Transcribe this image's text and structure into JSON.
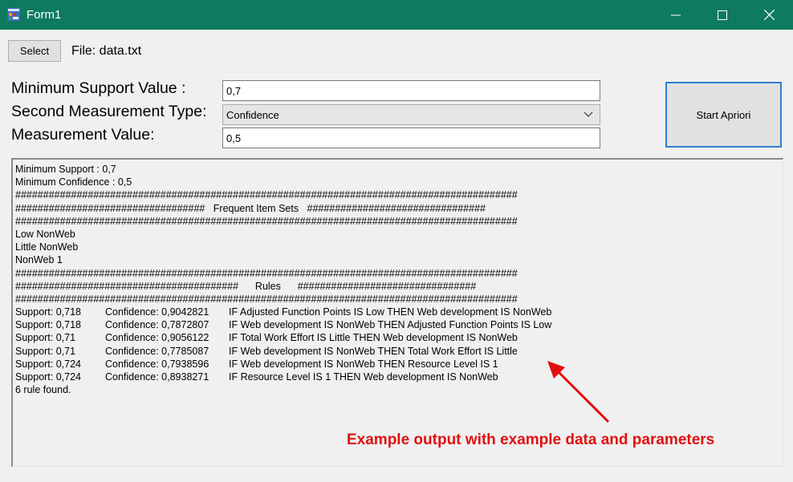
{
  "window": {
    "title": "Form1",
    "minimize_icon": "minimize-icon",
    "maximize_icon": "maximize-icon",
    "close_icon": "close-icon"
  },
  "file_bar": {
    "select_label": "Select",
    "file_label": "File: data.txt"
  },
  "form": {
    "min_support_label": "Minimum Support Value :",
    "min_support_value": "0,7",
    "measurement_type_label": "Second Measurement Type:",
    "measurement_type_selected": "Confidence",
    "measurement_value_label": "Measurement Value:",
    "measurement_value": "0,5",
    "start_label": "Start Apriori"
  },
  "output": {
    "header_lines": [
      "Minimum Support : 0,7",
      "Minimum Confidence : 0,5",
      "##########################################################################################",
      "##################################   Frequent Item Sets   ################################",
      "##########################################################################################",
      "Low NonWeb",
      "Little NonWeb",
      "NonWeb 1",
      "##########################################################################################",
      "########################################      Rules      ################################",
      "##########################################################################################"
    ],
    "rules": [
      {
        "support": "Support: 0,718",
        "confidence": "Confidence: 0,9042821",
        "rule": "IF Adjusted Function Points IS Low THEN Web development IS NonWeb"
      },
      {
        "support": "Support: 0,718",
        "confidence": "Confidence: 0,7872807",
        "rule": "IF Web development IS NonWeb THEN Adjusted Function Points IS Low"
      },
      {
        "support": "Support: 0,71",
        "confidence": "Confidence: 0,9056122",
        "rule": "IF Total Work Effort IS Little THEN Web development IS NonWeb"
      },
      {
        "support": "Support: 0,71",
        "confidence": "Confidence: 0,7785087",
        "rule": "IF Web development IS NonWeb THEN Total Work Effort IS Little"
      },
      {
        "support": "Support: 0,724",
        "confidence": "Confidence: 0,7938596",
        "rule": "IF Web development IS NonWeb THEN Resource Level IS 1"
      },
      {
        "support": "Support: 0,724",
        "confidence": "Confidence: 0,8938271",
        "rule": "IF Resource Level IS 1 THEN Web development IS NonWeb"
      }
    ],
    "footer": "6 rule found."
  },
  "annotation": {
    "text": "Example output with example data and parameters",
    "color": "#e01010"
  },
  "colors": {
    "titlebar": "#0e7a5f",
    "focus_border": "#2f7fcf"
  }
}
